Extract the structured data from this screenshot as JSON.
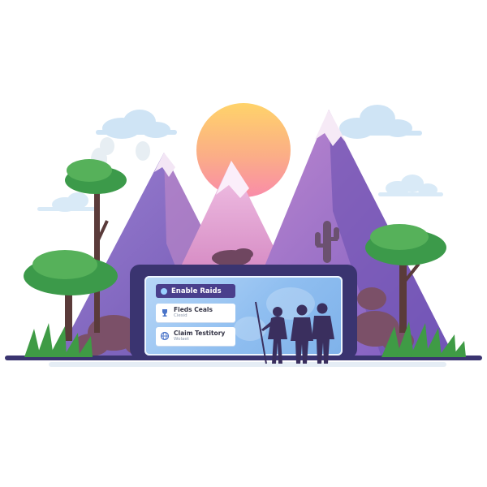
{
  "panel": {
    "enable_button_label": "Enable Raids",
    "cards": [
      {
        "title": "Fieds Ceals",
        "subtitle": "Ciesid",
        "icon": "trophy-icon"
      },
      {
        "title": "Claim Testitory",
        "subtitle": "Wolaet",
        "icon": "globe-icon"
      }
    ]
  },
  "colors": {
    "sun_top": "#ffd36a",
    "sun_bottom": "#f98ca9",
    "mountain": "#7f63bf",
    "frame": "#3a3470",
    "tree": "#3c9a4a",
    "button": "#4a3f8c"
  }
}
